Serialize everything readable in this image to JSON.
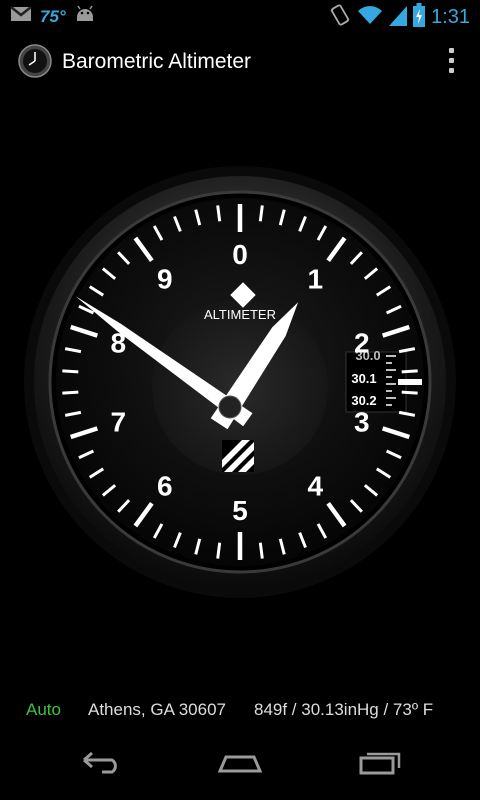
{
  "status_bar": {
    "temperature": "75°",
    "time": "1:31",
    "icons": [
      "gmail-icon",
      "android-icon",
      "vibrate-icon",
      "wifi-icon",
      "signal-icon",
      "battery-icon"
    ]
  },
  "action_bar": {
    "title": "Barometric Altimeter",
    "app_icon": "altimeter-clock-icon",
    "menu_icon": "overflow-menu-icon"
  },
  "gauge": {
    "face_label": "ALTIMETER",
    "dial_numbers": [
      "0",
      "1",
      "2",
      "3",
      "4",
      "5",
      "6",
      "7",
      "8",
      "9"
    ],
    "kollsman_window": [
      "30.0",
      "30.1",
      "30.2"
    ],
    "altitude_feet": 849,
    "pressure_setting_inHg": 30.13,
    "colors": {
      "face": "#101010",
      "bezel": "#2a2a2a",
      "markings": "#ffffff"
    }
  },
  "info_bar": {
    "mode": "Auto",
    "location": "Athens, GA 30607",
    "reading": "849f / 30.13inHg  /  73º F",
    "mode_color": "#3ec43a"
  },
  "nav_bar": {
    "buttons": [
      "back-icon",
      "home-icon",
      "recent-apps-icon"
    ]
  }
}
